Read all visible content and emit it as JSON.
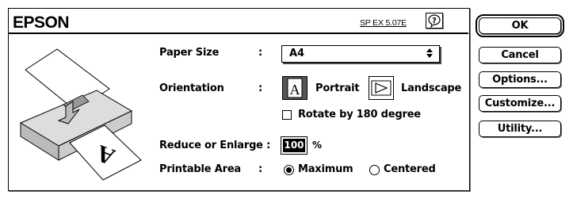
{
  "header": {
    "logo": "EPSON",
    "version": "SP EX 5.07E"
  },
  "fields": {
    "paper_size": {
      "label": "Paper Size",
      "colon": ":",
      "value": "A4"
    },
    "orientation": {
      "label": "Orientation",
      "colon": ":",
      "portrait": "Portrait",
      "landscape": "Landscape",
      "selected": "Portrait"
    },
    "rotate": {
      "label": "Rotate by 180 degree",
      "checked": false
    },
    "reduce": {
      "label": "Reduce or Enlarge :",
      "value": "100",
      "unit": "%"
    },
    "printable_area": {
      "label": "Printable Area",
      "colon": ":",
      "options": [
        "Maximum",
        "Centered"
      ],
      "selected": "Maximum"
    }
  },
  "buttons": {
    "ok": "OK",
    "cancel": "Cancel",
    "options": "Options...",
    "customize": "Customize...",
    "utility": "Utility..."
  },
  "icons": {
    "help": "help-balloon-icon",
    "printer": "printer-illustration",
    "portrait": "portrait-orientation-icon",
    "landscape": "landscape-orientation-icon"
  }
}
